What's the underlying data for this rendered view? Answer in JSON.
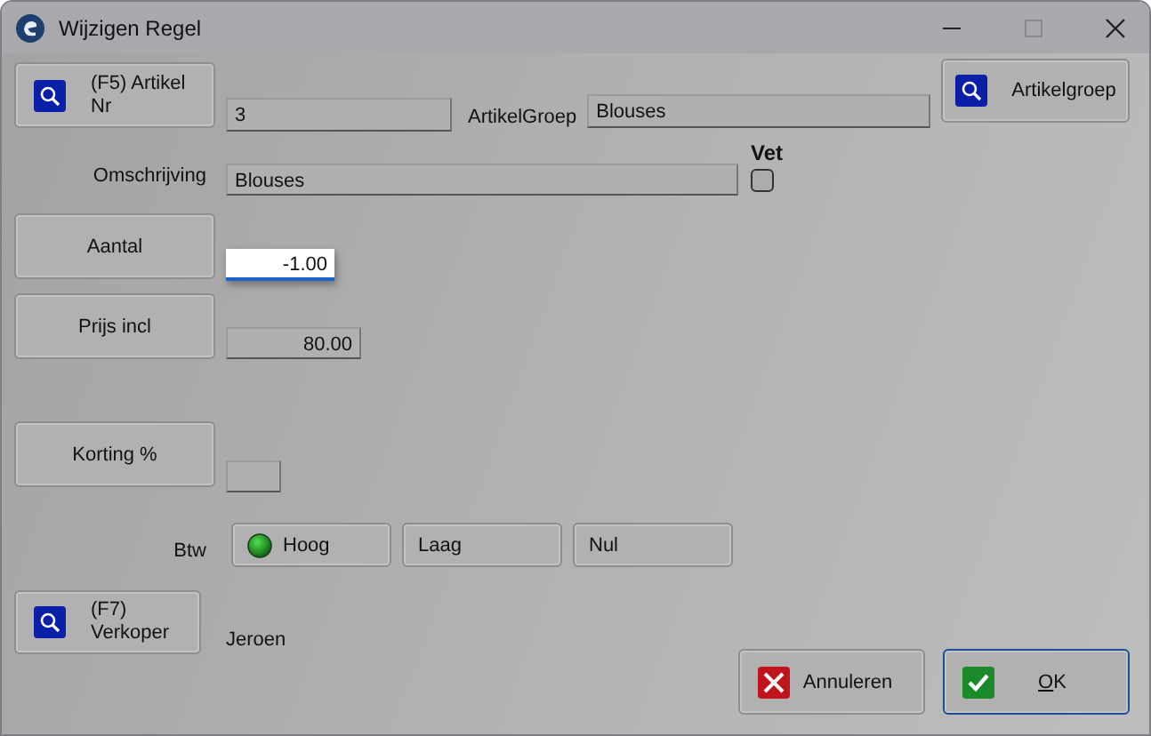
{
  "window": {
    "title": "Wijzigen Regel"
  },
  "artikel_nr": {
    "button": "(F5)  Artikel Nr",
    "value": "3"
  },
  "artikelgroep": {
    "label": "ArtikelGroep",
    "value": "Blouses",
    "button": "Artikelgroep"
  },
  "omschrijving": {
    "label": "Omschrijving",
    "value": "Blouses"
  },
  "vet": {
    "label": "Vet",
    "checked": false
  },
  "aantal": {
    "button": "Aantal",
    "value": "-1.00",
    "focused": true
  },
  "prijs_incl": {
    "button": "Prijs incl",
    "value": "80.00"
  },
  "korting": {
    "button": "Korting %"
  },
  "btw": {
    "label": "Btw",
    "options": [
      {
        "label": "Hoog",
        "selected": true
      },
      {
        "label": "Laag",
        "selected": false
      },
      {
        "label": "Nul",
        "selected": false
      }
    ]
  },
  "verkoper": {
    "button": "(F7) Verkoper",
    "value": "Jeroen"
  },
  "buttons": [
    {
      "kind": "cancel",
      "label": "Annuleren",
      "default": false,
      "underline_first": false
    },
    {
      "kind": "ok",
      "label": "OK",
      "default": true,
      "underline_first": true
    }
  ]
}
